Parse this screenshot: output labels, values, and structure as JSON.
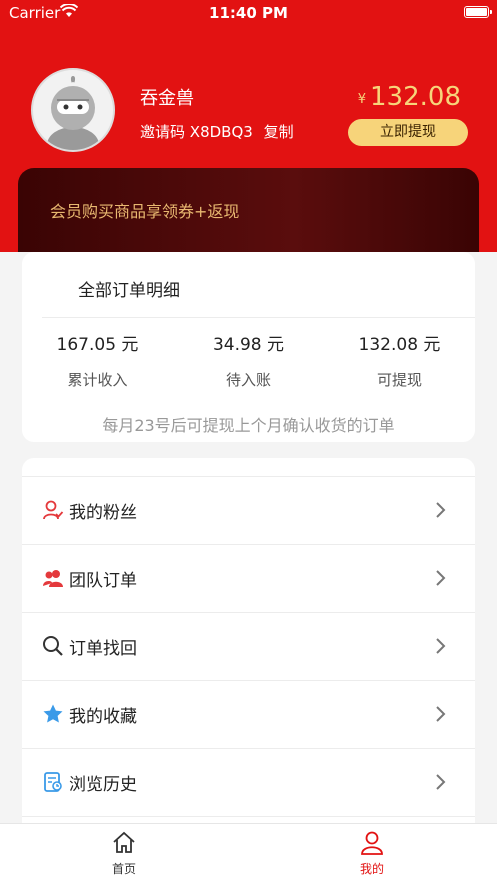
{
  "status_bar": {
    "carrier": "Carrier",
    "time": "11:40 PM"
  },
  "profile": {
    "username": "吞金兽",
    "invite_label": "邀请码",
    "invite_code": "X8DBQ3",
    "copy_label": "复制",
    "currency_symbol": "¥",
    "balance": "132.08",
    "withdraw_button": "立即提现"
  },
  "vip_banner": {
    "text": "会员购买商品享领券+返现"
  },
  "orders": {
    "title": "全部订单明细",
    "stats": [
      {
        "value": "167.05 元",
        "label": "累计收入"
      },
      {
        "value": "34.98 元",
        "label": "待入账"
      },
      {
        "value": "132.08 元",
        "label": "可提现"
      }
    ],
    "note": "每月23号后可提现上个月确认收货的订单"
  },
  "menu": {
    "items": [
      {
        "label": "我的粉丝",
        "icon": "fans-icon"
      },
      {
        "label": "团队订单",
        "icon": "team-icon"
      },
      {
        "label": "订单找回",
        "icon": "search-icon"
      },
      {
        "label": "我的收藏",
        "icon": "star-icon"
      },
      {
        "label": "浏览历史",
        "icon": "history-icon"
      }
    ]
  },
  "tabbar": {
    "tabs": [
      {
        "label": "首页",
        "icon": "home-icon",
        "active": false
      },
      {
        "label": "我的",
        "icon": "user-icon",
        "active": true
      }
    ]
  },
  "colors": {
    "header_red": "#e21212",
    "gold": "#f7d47a",
    "banner_dark": "#3a0404",
    "active_tab": "#e21212"
  }
}
